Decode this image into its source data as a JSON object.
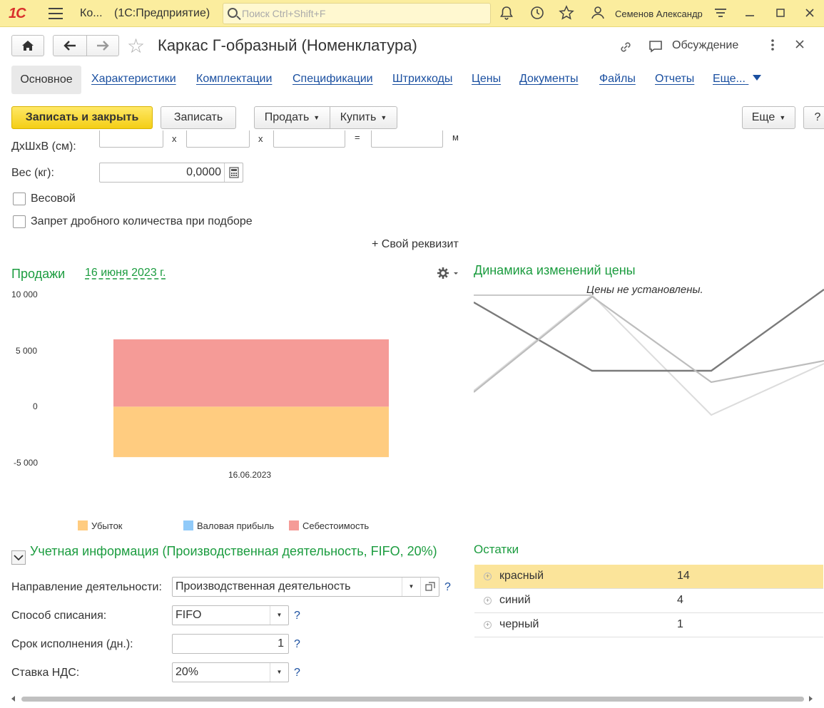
{
  "titlebar": {
    "logo": "1С",
    "app_short": "Ко...",
    "app_name": "(1С:Предприятие)",
    "search_placeholder": "Поиск Ctrl+Shift+F",
    "user": "Семенов Александр"
  },
  "header": {
    "title": "Каркас Г-образный (Номенклатура)",
    "discussion": "Обсуждение"
  },
  "tabs": {
    "active": "Основное",
    "items": [
      "Характеристики",
      "Комплектации",
      "Спецификации",
      "Штрихкоды",
      "Цены",
      "Документы",
      "Файлы",
      "Отчеты",
      "Еще..."
    ]
  },
  "commands": {
    "save_close": "Записать и закрыть",
    "save": "Записать",
    "sell": "Продать",
    "buy": "Купить",
    "more": "Еще",
    "help": "?"
  },
  "form": {
    "dims_label": "ДхШхВ (см):",
    "dims_sep_x1": "х",
    "dims_sep_x2": "х",
    "dims_sep_eq": "=",
    "dims_unit": "м",
    "weight_label": "Вес (кг):",
    "weight_value": "0,0000",
    "weighted_label": "Весовой",
    "fraction_label": "Запрет дробного количества при подборе",
    "custom_attr": "+ Свой реквизит"
  },
  "sales": {
    "title": "Продажи",
    "date_link": "16 июня 2023 г."
  },
  "chart_data": {
    "type": "bar",
    "stacked": true,
    "categories": [
      "16.06.2023"
    ],
    "series": [
      {
        "name": "Убыток",
        "values": [
          -4500
        ],
        "color": "#ffcc80"
      },
      {
        "name": "Валовая прибыль",
        "values": [
          0
        ],
        "color": "#90caf9"
      },
      {
        "name": "Себестоимость",
        "values": [
          6000
        ],
        "color": "#f59b97"
      }
    ],
    "yticks": [
      "10 000",
      "5 000",
      "0",
      "-5 000"
    ],
    "ylim": [
      -5000,
      10000
    ],
    "grid": false,
    "legend": "bottom"
  },
  "price_dynamics": {
    "title": "Динамика изменений цены",
    "note": "Цены не установлены."
  },
  "accounting": {
    "title": "Учетная информация (Производственная деятельность, FIFO, 20%)",
    "direction_label": "Направление деятельности:",
    "direction_value": "Производственная деятельность",
    "writeoff_label": "Способ списания:",
    "writeoff_value": "FIFO",
    "term_label": "Срок исполнения (дн.):",
    "term_value": "1",
    "vat_label": "Ставка НДС:",
    "vat_value": "20%",
    "help": "?"
  },
  "remains": {
    "title": "Остатки",
    "rows": [
      {
        "name": "красный",
        "qty": "14"
      },
      {
        "name": "синий",
        "qty": "4"
      },
      {
        "name": "черный",
        "qty": "1"
      }
    ]
  }
}
